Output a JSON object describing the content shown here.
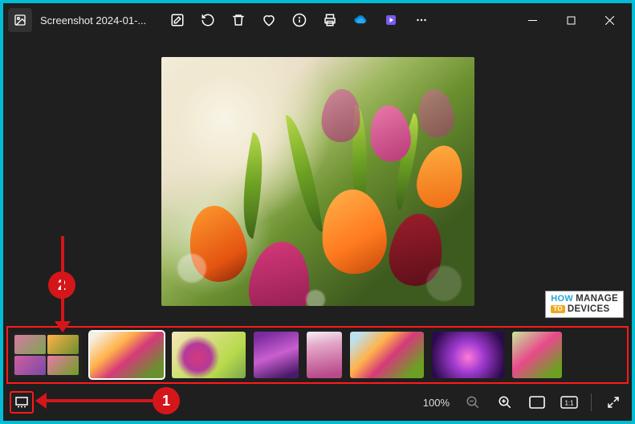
{
  "titlebar": {
    "filename": "Screenshot 2024-01-..."
  },
  "toolbar": {
    "edit": "Edit",
    "rotate": "Rotate",
    "delete": "Delete",
    "favorite": "Favorite",
    "info": "Info",
    "print": "Print",
    "onedrive": "OneDrive",
    "clipchamp": "Clipchamp",
    "more": "See more"
  },
  "window_controls": {
    "minimize": "Minimize",
    "maximize": "Maximize",
    "close": "Close"
  },
  "watermark": {
    "how": "HOW",
    "to": "TO",
    "manage": "MANAGE",
    "devices": "DEVICES"
  },
  "filmstrip": {
    "items": [
      {
        "id": "all-photos-grid",
        "selected": false
      },
      {
        "id": "tulips-bouquet-orange",
        "selected": true
      },
      {
        "id": "tulips-pink-green",
        "selected": false
      },
      {
        "id": "tulip-purple-single",
        "selected": false
      },
      {
        "id": "tulips-pink-portrait",
        "selected": false
      },
      {
        "id": "tulips-mixed-sky",
        "selected": false
      },
      {
        "id": "tulips-purple-neon",
        "selected": false
      },
      {
        "id": "tulips-pink-bunch",
        "selected": false
      }
    ]
  },
  "bottombar": {
    "zoom_label": "100%",
    "zoom_out": "Zoom out",
    "zoom_in": "Zoom in",
    "fit": "Fit to window",
    "actual": "Actual size",
    "fullscreen": "Full screen"
  },
  "annotations": {
    "step1": "1",
    "step2": "2"
  },
  "colors": {
    "annotation_red": "#d4161b",
    "cyan_border": "#00bcd4",
    "window_bg": "#1f1f1f"
  }
}
